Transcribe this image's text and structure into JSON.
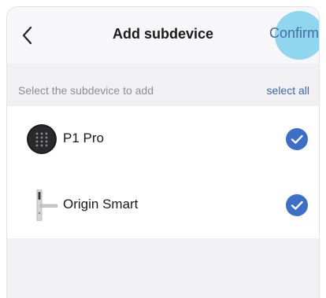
{
  "header": {
    "title": "Add subdevice",
    "confirm_label": "Confirm",
    "back_icon": "chevron-left-icon"
  },
  "section": {
    "label": "Select the subdevice to add",
    "select_all_label": "select all"
  },
  "devices": [
    {
      "name": "P1 Pro",
      "icon": "keypad-lock-icon",
      "selected": true
    },
    {
      "name": "Origin Smart",
      "icon": "door-handle-lock-icon",
      "selected": true
    }
  ],
  "colors": {
    "accent": "#3a66b3",
    "check": "#3d6fc9",
    "highlight": "#8fd6ee",
    "background": "#f1f1f3"
  }
}
